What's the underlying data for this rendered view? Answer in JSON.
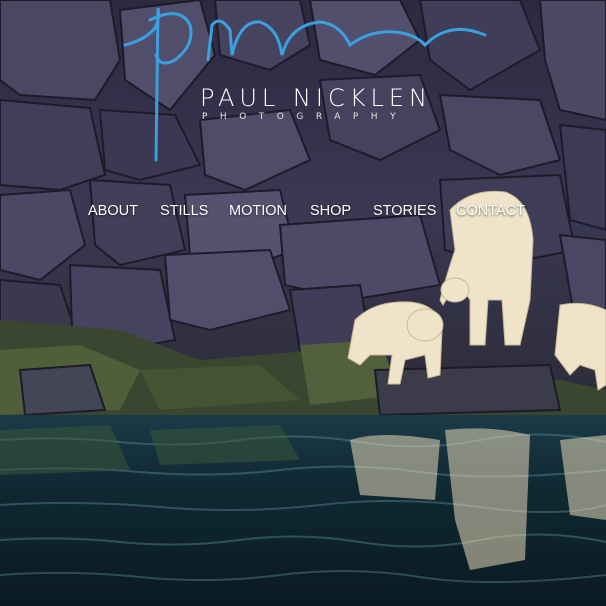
{
  "brand": {
    "name": "PAUL NICKLEN",
    "tagline": "PHOTOGRAPHY",
    "signature": "pn",
    "signature_color": "#3c9fe0"
  },
  "nav": {
    "items": [
      {
        "label": "ABOUT"
      },
      {
        "label": "STILLS"
      },
      {
        "label": "MOTION"
      },
      {
        "label": "SHOP"
      },
      {
        "label": "STORIES"
      },
      {
        "label": "CONTACT"
      }
    ]
  },
  "hero": {
    "scene": "basalt-rock-cliff-with-polar-bears-reflected-in-water",
    "colors": {
      "rock": "#3d3a55",
      "rock_light": "#6b6883",
      "moss": "#4a5a33",
      "water": "#0f2a36",
      "water_highlight": "#6fa6b0",
      "bear_fur": "#f0e4cc"
    }
  }
}
